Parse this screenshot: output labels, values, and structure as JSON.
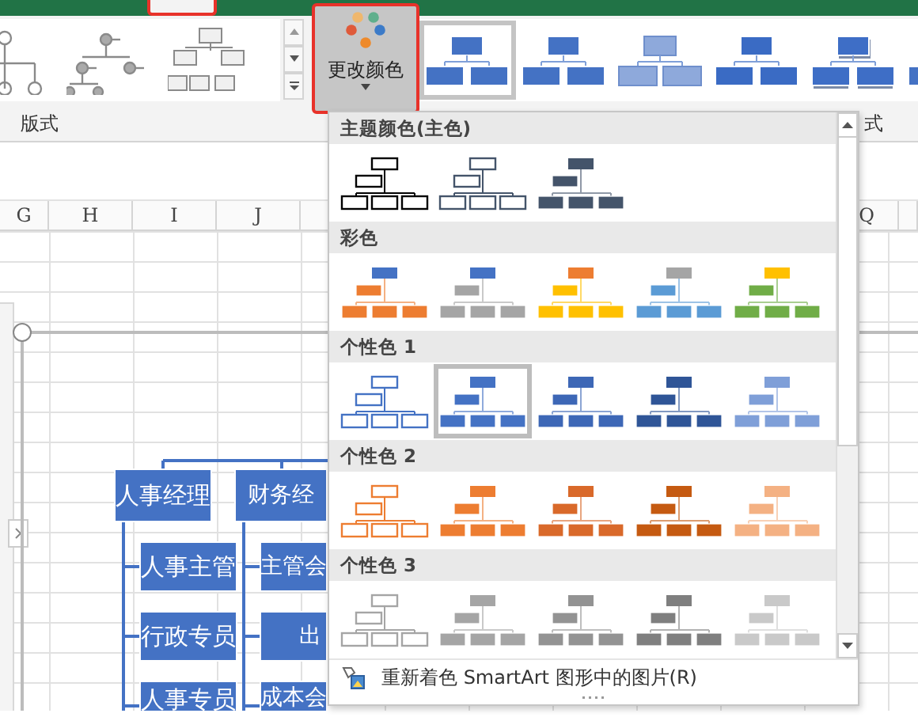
{
  "title_bar": {
    "tab_highlighted": true
  },
  "ribbon": {
    "layouts": [
      {
        "kind": "circle"
      },
      {
        "kind": "dot"
      },
      {
        "kind": "box"
      }
    ],
    "change_color_button": {
      "label": "更改颜色",
      "highlighted": true
    },
    "styles": [
      {
        "kind": "flat",
        "selected": true
      },
      {
        "kind": "flat",
        "selected": false
      },
      {
        "kind": "light",
        "selected": false
      },
      {
        "kind": "gradient",
        "selected": false
      },
      {
        "kind": "shadow",
        "selected": false
      },
      {
        "kind": "flat",
        "selected": false
      }
    ],
    "group_labels": [
      "版式",
      "式"
    ]
  },
  "sheet": {
    "columns": [
      "G",
      "H",
      "I",
      "J",
      "Q"
    ],
    "org_chart": [
      {
        "text": "人事经理",
        "children": [
          {
            "text": "人事主管"
          },
          {
            "text": "行政专员"
          },
          {
            "text": "人事专员"
          }
        ]
      },
      {
        "text": "财务经",
        "children": [
          {
            "text": "主管会"
          },
          {
            "text": "出"
          },
          {
            "text": "成本会"
          }
        ]
      }
    ]
  },
  "dropdown": {
    "sections": [
      {
        "title": "主题颜色(主色)",
        "options": [
          {
            "kind": "outline",
            "color": "#000000",
            "selected": false
          },
          {
            "kind": "outline",
            "color": "#44546a",
            "selected": false
          },
          {
            "kind": "fill",
            "color": "#44546a",
            "selected": false
          }
        ]
      },
      {
        "title": "彩色",
        "options": [
          {
            "kind": "fill",
            "color": "#ed7d31",
            "top": {
              "color": "#4472c4"
            },
            "selected": false
          },
          {
            "kind": "fill",
            "color": "#a5a5a5",
            "top": {
              "color": "#4472c4"
            },
            "selected": false
          },
          {
            "kind": "fill",
            "color": "#ffc000",
            "top": {
              "color": "#ed7d31"
            },
            "selected": false
          },
          {
            "kind": "fill",
            "color": "#5b9bd5",
            "top": {
              "color": "#a5a5a5"
            },
            "selected": false
          },
          {
            "kind": "fill",
            "color": "#70ad47",
            "top": {
              "color": "#ffc000"
            },
            "selected": false
          }
        ]
      },
      {
        "title": "个性色 1",
        "options": [
          {
            "kind": "outline",
            "color": "#4472c4",
            "selected": false
          },
          {
            "kind": "fill",
            "color": "#4472c4",
            "selected": true
          },
          {
            "kind": "fill",
            "color": "#3d67b6",
            "selected": false
          },
          {
            "kind": "fill",
            "color": "#2f5597",
            "selected": false
          },
          {
            "kind": "fill",
            "color": "#7f9fd8",
            "selected": false
          }
        ]
      },
      {
        "title": "个性色 2",
        "options": [
          {
            "kind": "outline",
            "color": "#ed7d31",
            "selected": false
          },
          {
            "kind": "fill",
            "color": "#ed7d31",
            "selected": false
          },
          {
            "kind": "fill",
            "color": "#d9692a",
            "selected": false
          },
          {
            "kind": "fill",
            "color": "#c55a11",
            "selected": false
          },
          {
            "kind": "fill",
            "color": "#f4b183",
            "selected": false
          }
        ]
      },
      {
        "title": "个性色 3",
        "options": [
          {
            "kind": "outline",
            "color": "#a5a5a5",
            "selected": false
          },
          {
            "kind": "fill",
            "color": "#a5a5a5",
            "selected": false
          },
          {
            "kind": "fill",
            "color": "#939393",
            "selected": false
          },
          {
            "kind": "fill",
            "color": "#7f7f7f",
            "selected": false
          },
          {
            "kind": "fill",
            "color": "#c9c9c9",
            "selected": false
          }
        ]
      }
    ],
    "footer": "重新着色 SmartArt 图形中的图片(R)"
  }
}
